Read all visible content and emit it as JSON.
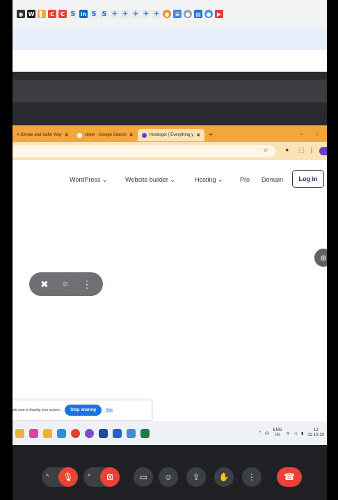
{
  "browser": {
    "tabs": [
      {
        "label": "A Simple and Safer Way"
      },
      {
        "label": "stripe - Google Search"
      },
      {
        "label": "Hostinger | Everything y"
      }
    ],
    "new_tab": "+",
    "minimize": "–"
  },
  "site": {
    "nav": {
      "wordpress": "WordPress ⌄",
      "website_builder": "Website builder ⌄",
      "hosting": "Hosting ⌄",
      "pro": "Pro",
      "domain": "Domain"
    },
    "login_label": "Log in"
  },
  "sharing": {
    "message": "ple.com is sharing your screen.",
    "stop_label": "Stop sharing",
    "hide_label": "Hide"
  },
  "tray": {
    "lang_top": "ENG",
    "lang_bottom": "IN",
    "time": "12",
    "date": "11-10-20"
  },
  "colors": {
    "meet_bg": "#202124",
    "accent_red": "#ea4335",
    "share_blue": "#1a73e8",
    "tab_orange": "#f4a63a"
  }
}
